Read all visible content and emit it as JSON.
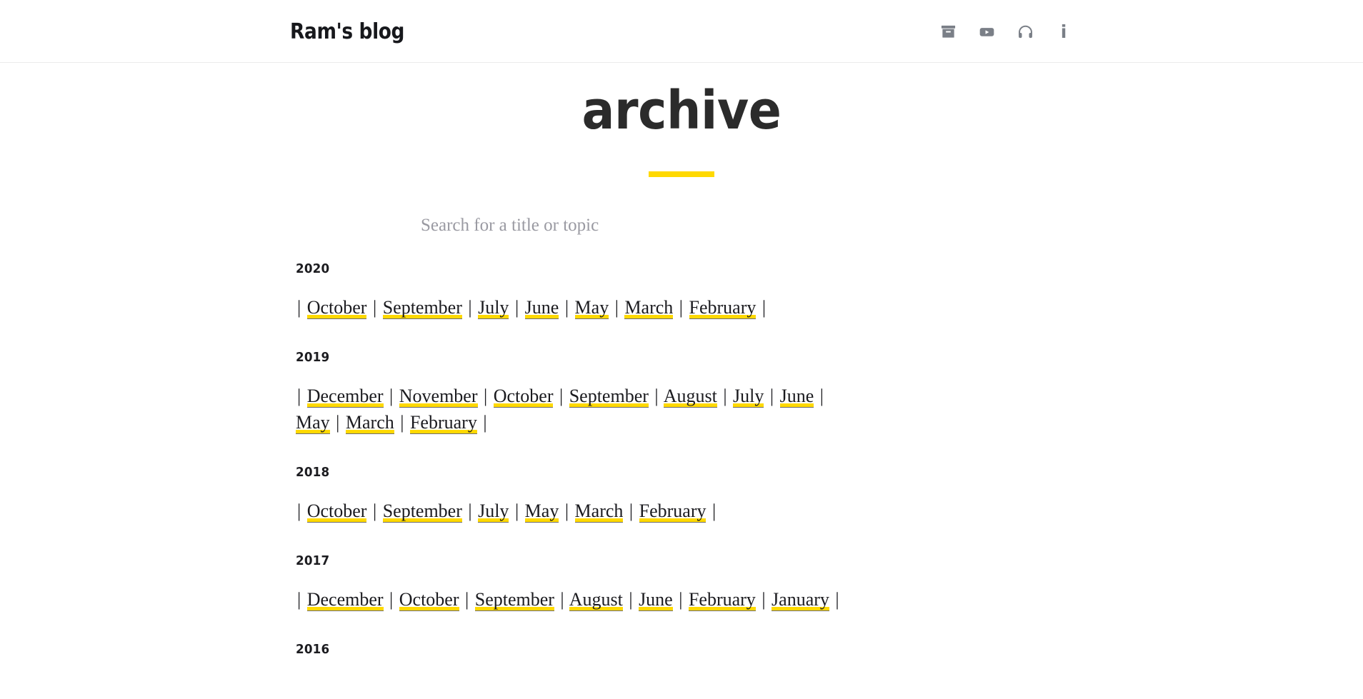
{
  "header": {
    "site_title": "Ram's blog",
    "icons": [
      {
        "name": "archive-icon",
        "label": "Archive"
      },
      {
        "name": "youtube-icon",
        "label": "YouTube"
      },
      {
        "name": "headphones-icon",
        "label": "Podcast"
      },
      {
        "name": "info-icon",
        "label": "About",
        "glyph": "i"
      }
    ]
  },
  "page": {
    "title": "archive",
    "accent_color": "#ffd900",
    "text_color": "#1b1b1f"
  },
  "search": {
    "placeholder": "Search for a title or topic",
    "value": ""
  },
  "archive": {
    "years": [
      {
        "year": "2020",
        "months": [
          "October",
          "September",
          "July",
          "June",
          "May",
          "March",
          "February"
        ]
      },
      {
        "year": "2019",
        "months": [
          "December",
          "November",
          "October",
          "September",
          "August",
          "July",
          "June",
          "May",
          "March",
          "February"
        ]
      },
      {
        "year": "2018",
        "months": [
          "October",
          "September",
          "July",
          "May",
          "March",
          "February"
        ]
      },
      {
        "year": "2017",
        "months": [
          "December",
          "October",
          "September",
          "August",
          "June",
          "February",
          "January"
        ]
      },
      {
        "year": "2016",
        "months": []
      }
    ]
  }
}
